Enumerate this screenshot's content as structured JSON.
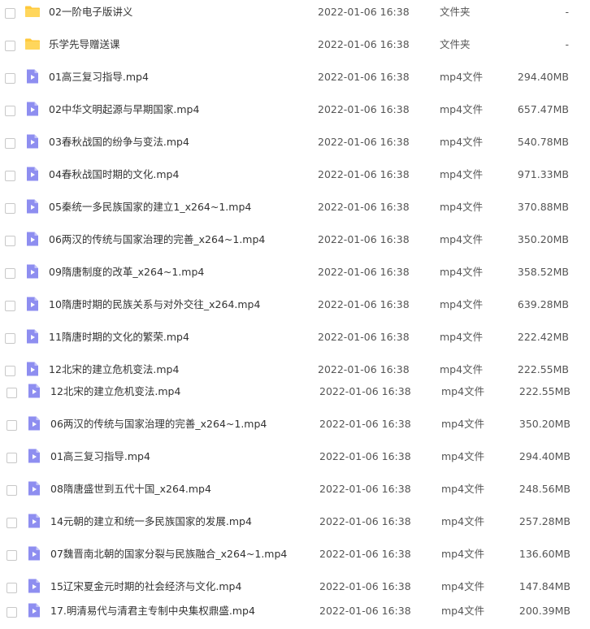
{
  "colors": {
    "folder_icon": "#FFC93C",
    "video_icon": "#8E8EF0",
    "checkbox_border": "#C8C8C8"
  },
  "files": [
    {
      "name": "02一阶电子版讲义",
      "date": "2022-01-06 16:38",
      "type": "文件夹",
      "size": "-",
      "icon": "folder-icon"
    },
    {
      "name": "乐学先导赠送课",
      "date": "2022-01-06 16:38",
      "type": "文件夹",
      "size": "-",
      "icon": "folder-icon"
    },
    {
      "name": "01高三复习指导.mp4",
      "date": "2022-01-06 16:38",
      "type": "mp4文件",
      "size": "294.40MB",
      "icon": "video-file-icon"
    },
    {
      "name": "02中华文明起源与早期国家.mp4",
      "date": "2022-01-06 16:38",
      "type": "mp4文件",
      "size": "657.47MB",
      "icon": "video-file-icon"
    },
    {
      "name": "03春秋战国的纷争与变法.mp4",
      "date": "2022-01-06 16:38",
      "type": "mp4文件",
      "size": "540.78MB",
      "icon": "video-file-icon"
    },
    {
      "name": "04春秋战国时期的文化.mp4",
      "date": "2022-01-06 16:38",
      "type": "mp4文件",
      "size": "971.33MB",
      "icon": "video-file-icon"
    },
    {
      "name": "05秦统一多民族国家的建立1_x264~1.mp4",
      "date": "2022-01-06 16:38",
      "type": "mp4文件",
      "size": "370.88MB",
      "icon": "video-file-icon"
    },
    {
      "name": "06两汉的传统与国家治理的完善_x264~1.mp4",
      "date": "2022-01-06 16:38",
      "type": "mp4文件",
      "size": "350.20MB",
      "icon": "video-file-icon"
    },
    {
      "name": "09隋唐制度的改革_x264~1.mp4",
      "date": "2022-01-06 16:38",
      "type": "mp4文件",
      "size": "358.52MB",
      "icon": "video-file-icon"
    },
    {
      "name": "10隋唐时期的民族关系与对外交往_x264.mp4",
      "date": "2022-01-06 16:38",
      "type": "mp4文件",
      "size": "639.28MB",
      "icon": "video-file-icon"
    },
    {
      "name": "11隋唐时期的文化的繁荣.mp4",
      "date": "2022-01-06 16:38",
      "type": "mp4文件",
      "size": "222.42MB",
      "icon": "video-file-icon"
    },
    {
      "name": "12北宋的建立危机变法.mp4",
      "date": "2022-01-06 16:38",
      "type": "mp4文件",
      "size": "222.55MB",
      "icon": "video-file-icon"
    },
    {
      "name": "12北宋的建立危机变法.mp4",
      "date": "2022-01-06 16:38",
      "type": "mp4文件",
      "size": "222.55MB",
      "icon": "video-file-icon"
    },
    {
      "name": "06两汉的传统与国家治理的完善_x264~1.mp4",
      "date": "2022-01-06 16:38",
      "type": "mp4文件",
      "size": "350.20MB",
      "icon": "video-file-icon"
    },
    {
      "name": "01高三复习指导.mp4",
      "date": "2022-01-06 16:38",
      "type": "mp4文件",
      "size": "294.40MB",
      "icon": "video-file-icon"
    },
    {
      "name": "08隋唐盛世到五代十国_x264.mp4",
      "date": "2022-01-06 16:38",
      "type": "mp4文件",
      "size": "248.56MB",
      "icon": "video-file-icon"
    },
    {
      "name": "14元朝的建立和统一多民族国家的发展.mp4",
      "date": "2022-01-06 16:38",
      "type": "mp4文件",
      "size": "257.28MB",
      "icon": "video-file-icon"
    },
    {
      "name": "07魏晋南北朝的国家分裂与民族融合_x264~1.mp4",
      "date": "2022-01-06 16:38",
      "type": "mp4文件",
      "size": "136.60MB",
      "icon": "video-file-icon"
    },
    {
      "name": "15辽宋夏金元时期的社会经济与文化.mp4",
      "date": "2022-01-06 16:38",
      "type": "mp4文件",
      "size": "147.84MB",
      "icon": "video-file-icon"
    },
    {
      "name": "17.明清易代与清君主专制中央集权鼎盛.mp4",
      "date": "2022-01-06 16:38",
      "type": "mp4文件",
      "size": "200.39MB",
      "icon": "video-file-icon"
    }
  ]
}
